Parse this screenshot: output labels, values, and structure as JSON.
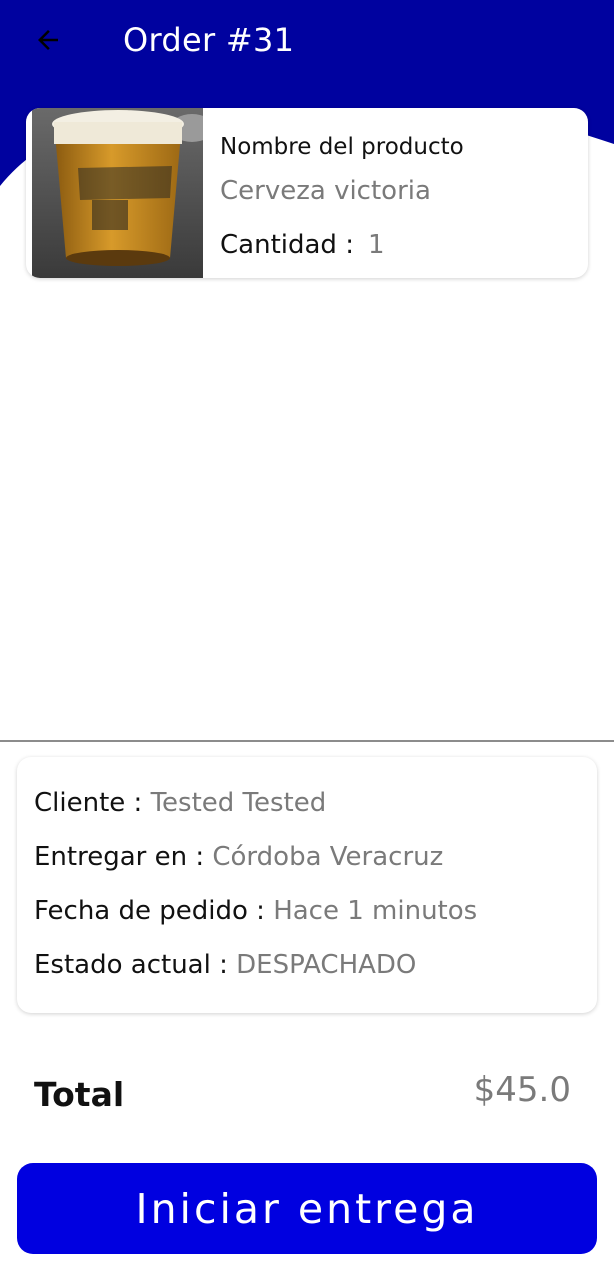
{
  "app_bar": {
    "title": "Order #31",
    "back_icon": "arrow-left-icon"
  },
  "colors": {
    "app_bar": "#00029f",
    "primary_button": "#0000e0",
    "secondary_text": "#7a7a7a"
  },
  "product": {
    "image_icon": "beer-glass-photo",
    "name_label": "Nombre del producto",
    "name_value": "Cerveza victoria",
    "quantity_label": "Cantidad :",
    "quantity_value": "1"
  },
  "details": {
    "client_label": "Cliente :",
    "client_value": "Tested Tested",
    "deliver_label": "Entregar en :",
    "deliver_value": "Córdoba Veracruz",
    "date_label": "Fecha de pedido :",
    "date_value": "Hace 1 minutos",
    "status_label": "Estado actual :",
    "status_value": "DESPACHADO"
  },
  "total": {
    "label": "Total",
    "value": "$45.0"
  },
  "actions": {
    "start_delivery_label": "Iniciar entrega"
  }
}
